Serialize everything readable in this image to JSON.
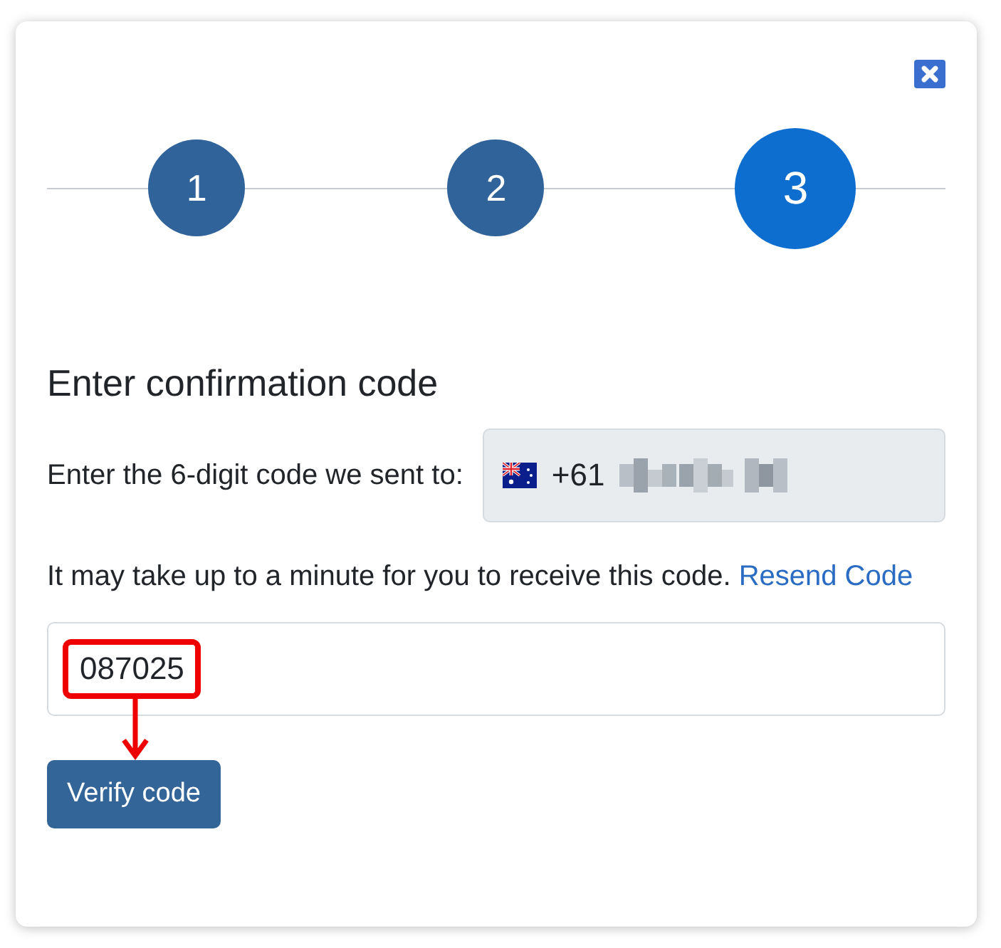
{
  "steps": [
    {
      "label": "1",
      "selected": false
    },
    {
      "label": "2",
      "selected": false
    },
    {
      "label": "3",
      "selected": true
    }
  ],
  "heading": "Enter confirmation code",
  "prompt": "Enter the 6-digit code we sent to:",
  "phone": {
    "prefix": "+61"
  },
  "note": "It may take up to a minute for you to receive this code.",
  "resend_link": "Resend Code",
  "code_field": {
    "value": "087025",
    "highlighted": true
  },
  "verify_button": "Verify code"
}
